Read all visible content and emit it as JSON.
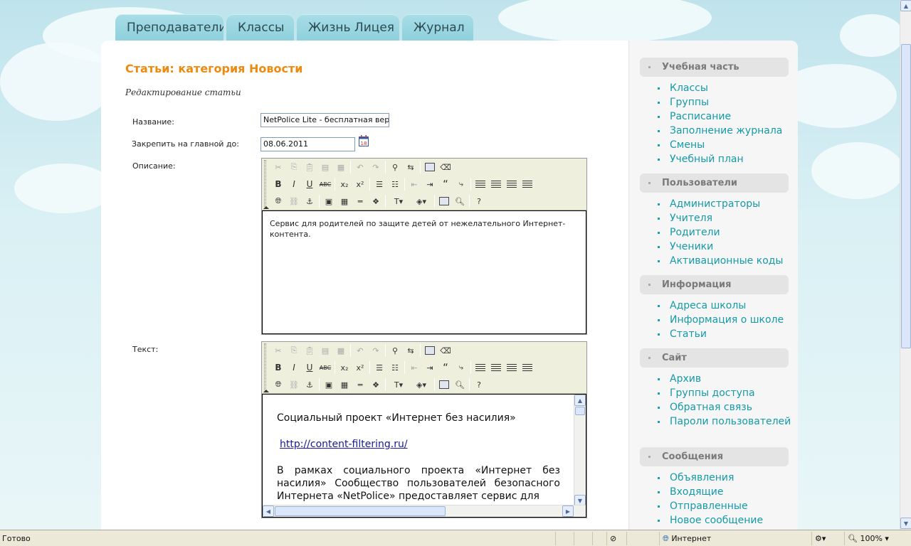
{
  "tabs": [
    {
      "label": "Преподаватели"
    },
    {
      "label": "Классы"
    },
    {
      "label": "Жизнь Лицея"
    },
    {
      "label": "Журнал"
    }
  ],
  "page": {
    "title": "Статьи: категория Новости",
    "subtitle": "Редактирование статьи"
  },
  "form": {
    "name_label": "Название:",
    "name_value": "NetPolice Lite - бесплатная вер",
    "pin_label": "Закрепить на главной до:",
    "pin_value": "08.06.2011",
    "calendar_day": "18",
    "desc_label": "Описание:",
    "desc_text": "Сервис для родителей по защите детей от нежелательного Интернет-контента.",
    "text_label": "Текст:",
    "text_heading": "Социальный проект «Интернет без насилия»",
    "text_link": "http://content-filtering.ru/",
    "text_paragraph": "В рамках социального проекта «Интернет без насилия» Сообщество пользователей безопасного Интернета «NetPolice» предоставляет сервис для"
  },
  "sidebar": {
    "sections": [
      {
        "title": "Учебная часть",
        "items": [
          "Классы",
          "Группы",
          "Расписание",
          "Заполнение журнала",
          "Смены",
          "Учебный план"
        ]
      },
      {
        "title": "Пользователи",
        "items": [
          "Администраторы",
          "Учителя",
          "Родители",
          "Ученики",
          "Активационные коды"
        ]
      },
      {
        "title": "Информация",
        "items": [
          "Адреса школы",
          "Информация о школе",
          "Статьи"
        ]
      },
      {
        "title": "Сайт",
        "items": [
          "Архив",
          "Группы доступа",
          "Обратная связь",
          "Пароли пользователей"
        ]
      },
      {
        "title": "Сообщения",
        "items": [
          "Объявления",
          "Входящие",
          "Отправленные",
          "Новое сообщение"
        ]
      }
    ]
  },
  "statusbar": {
    "status": "Готово",
    "zone": "Интернет",
    "zoom": "100%"
  },
  "colors": {
    "title": "#ee8a10",
    "link": "#159aa8"
  }
}
